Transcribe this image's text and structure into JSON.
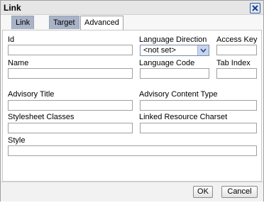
{
  "dialog": {
    "title": "Link",
    "close_icon": "close-icon",
    "tabs": [
      {
        "label": "Link Info",
        "active": false
      },
      {
        "label": "Target",
        "active": false
      },
      {
        "label": "Advanced",
        "active": true
      }
    ]
  },
  "form": {
    "id_label": "Id",
    "id_value": "",
    "language_direction_label": "Language Direction",
    "language_direction_value": "<not set>",
    "access_key_label": "Access Key",
    "access_key_value": "",
    "name_label": "Name",
    "name_value": "",
    "language_code_label": "Language Code",
    "language_code_value": "",
    "tab_index_label": "Tab Index",
    "tab_index_value": "",
    "advisory_title_label": "Advisory Title",
    "advisory_title_value": "",
    "advisory_content_type_label": "Advisory Content Type",
    "advisory_content_type_value": "",
    "stylesheet_classes_label": "Stylesheet Classes",
    "stylesheet_classes_value": "",
    "linked_resource_charset_label": "Linked Resource Charset",
    "linked_resource_charset_value": "",
    "style_label": "Style",
    "style_value": ""
  },
  "buttons": {
    "ok": "OK",
    "cancel": "Cancel"
  }
}
